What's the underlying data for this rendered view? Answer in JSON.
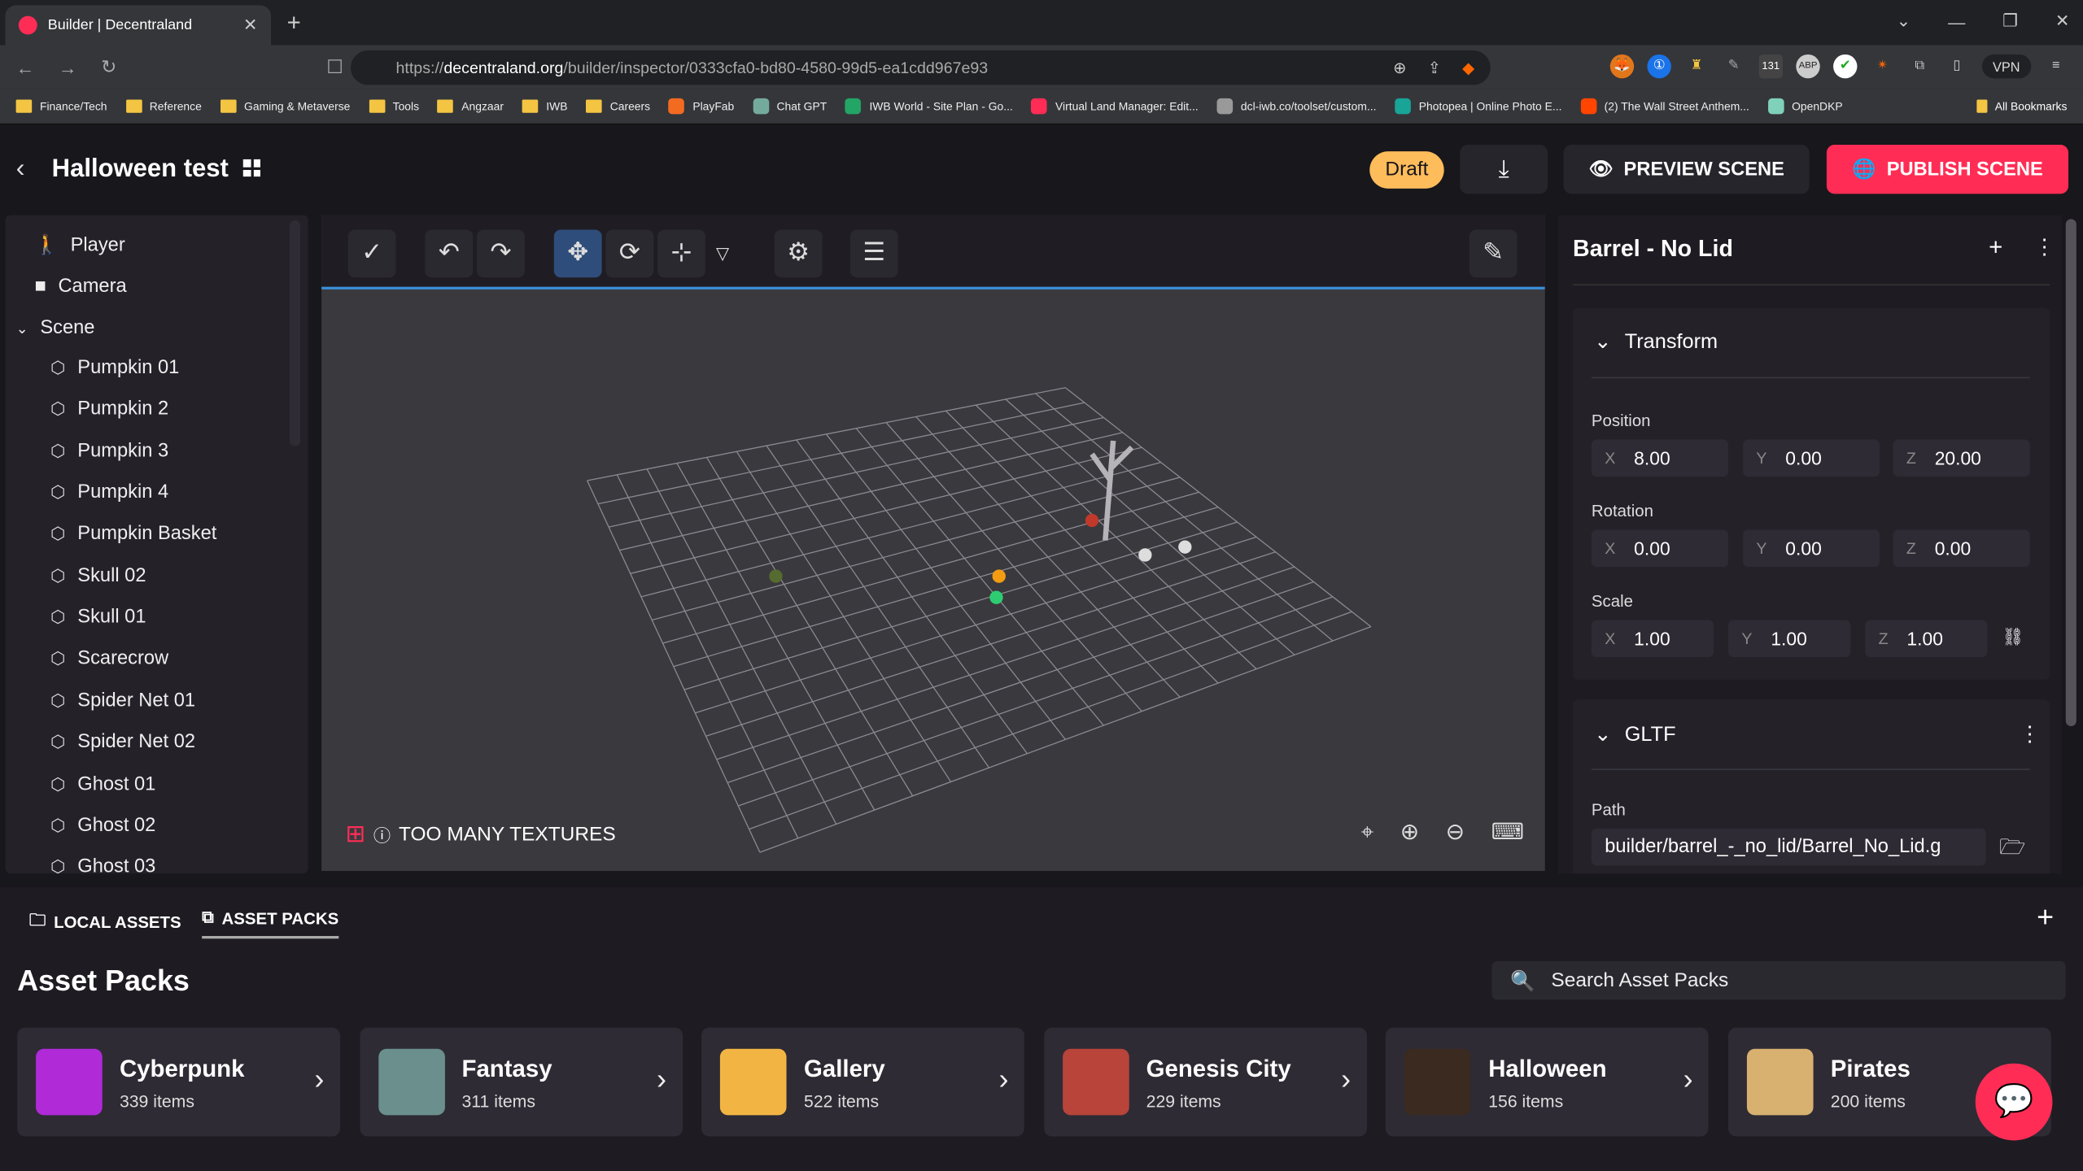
{
  "browser": {
    "tab_title": "Builder | Decentraland",
    "url_prefix": "https://",
    "url_domain": "decentraland.org",
    "url_path": "/builder/inspector/0333cfa0-bd80-4580-99d5-ea1cdd967e93",
    "vpn_label": "VPN",
    "ext_badge": "131",
    "bookmarks": [
      {
        "label": "Finance/Tech",
        "icon": "folder-icon"
      },
      {
        "label": "Reference",
        "icon": "folder-icon"
      },
      {
        "label": "Gaming & Metaverse",
        "icon": "folder-icon"
      },
      {
        "label": "Tools",
        "icon": "folder-icon"
      },
      {
        "label": "Angzaar",
        "icon": "folder-icon"
      },
      {
        "label": "IWB",
        "icon": "folder-icon"
      },
      {
        "label": "Careers",
        "icon": "folder-icon"
      },
      {
        "label": "PlayFab",
        "icon": "playfab-icon",
        "color": "#f26b21"
      },
      {
        "label": "Chat GPT",
        "icon": "chatgpt-icon",
        "color": "#74aa9c"
      },
      {
        "label": "IWB World - Site Plan - Go...",
        "icon": "sheets-icon",
        "color": "#23a566"
      },
      {
        "label": "Virtual Land Manager: Edit...",
        "icon": "dcl-icon",
        "color": "#ff2d55"
      },
      {
        "label": "dcl-iwb.co/toolset/custom...",
        "icon": "globe-icon",
        "color": "#999999"
      },
      {
        "label": "Photopea | Online Photo E...",
        "icon": "photopea-icon",
        "color": "#18a497"
      },
      {
        "label": "(2) The Wall Street Anthem...",
        "icon": "reddit-icon",
        "color": "#ff4500"
      },
      {
        "label": "OpenDKP",
        "icon": "opendkp-icon",
        "color": "#7fd1b9"
      }
    ],
    "all_bookmarks": "All Bookmarks"
  },
  "header": {
    "title": "Halloween test",
    "draft": "Draft",
    "preview": "PREVIEW SCENE",
    "publish": "PUBLISH SCENE"
  },
  "hierarchy": {
    "top": [
      {
        "label": "Player",
        "icon": "player-icon"
      },
      {
        "label": "Camera",
        "icon": "camera-icon"
      }
    ],
    "scene_label": "Scene",
    "entities": [
      "Pumpkin 01",
      "Pumpkin 2",
      "Pumpkin 3",
      "Pumpkin 4",
      "Pumpkin Basket",
      "Skull 02",
      "Skull 01",
      "Scarecrow",
      "Spider Net 01",
      "Spider Net 02",
      "Ghost 01",
      "Ghost 02",
      "Ghost 03"
    ]
  },
  "viewport": {
    "warning": "TOO MANY TEXTURES"
  },
  "inspector": {
    "title": "Barrel - No Lid",
    "transform": {
      "label": "Transform",
      "position_label": "Position",
      "position": {
        "x": "8.00",
        "y": "0.00",
        "z": "20.00"
      },
      "rotation_label": "Rotation",
      "rotation": {
        "x": "0.00",
        "y": "0.00",
        "z": "0.00"
      },
      "scale_label": "Scale",
      "scale": {
        "x": "1.00",
        "y": "1.00",
        "z": "1.00"
      }
    },
    "gltf": {
      "label": "GLTF",
      "path_label": "Path",
      "path": "builder/barrel_-_no_lid/Barrel_No_Lid.g"
    }
  },
  "assets": {
    "tab_local": "LOCAL ASSETS",
    "tab_packs": "ASSET PACKS",
    "title": "Asset Packs",
    "search_placeholder": "Search Asset Packs",
    "packs": [
      {
        "name": "Cyberpunk",
        "count": "339 items",
        "color": "#b02ad8"
      },
      {
        "name": "Fantasy",
        "count": "311 items",
        "color": "#6a8f8c"
      },
      {
        "name": "Gallery",
        "count": "522 items",
        "color": "#f2b544"
      },
      {
        "name": "Genesis City",
        "count": "229 items",
        "color": "#b8443a"
      },
      {
        "name": "Halloween",
        "count": "156 items",
        "color": "#3a2a20"
      },
      {
        "name": "Pirates",
        "count": "200 items",
        "color": "#d8b070"
      }
    ]
  },
  "colors": {
    "accent": "#ff2d55",
    "draft": "#ffbc5b",
    "selection": "#3b8fd9"
  }
}
